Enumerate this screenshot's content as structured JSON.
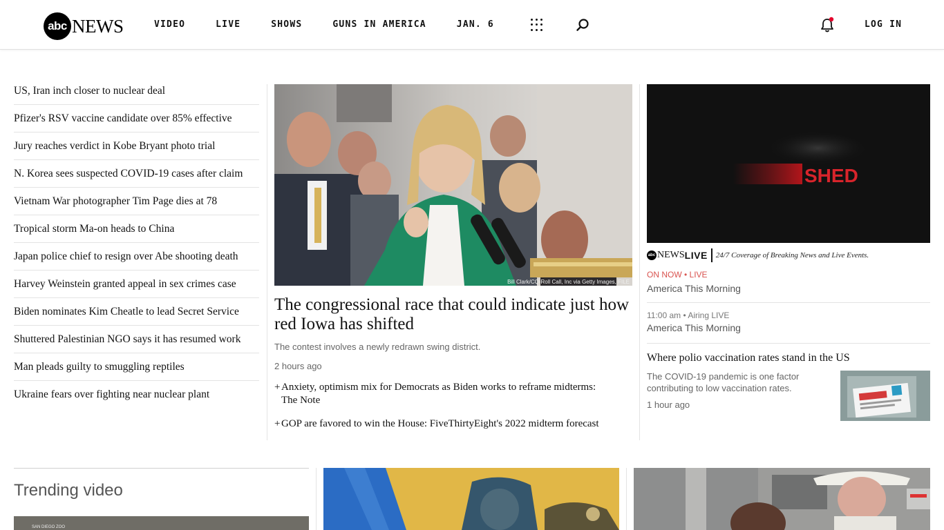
{
  "header": {
    "logo_mark": "abc",
    "logo_text": "NEWS",
    "nav": [
      "VIDEO",
      "LIVE",
      "SHOWS",
      "GUNS IN AMERICA",
      "JAN. 6"
    ],
    "login_label": "LOG IN"
  },
  "headlines": [
    "US, Iran inch closer to nuclear deal",
    "Pfizer's RSV vaccine candidate over 85% effective",
    "Jury reaches verdict in Kobe Bryant photo trial",
    "N. Korea sees suspected COVID-19 cases after claim",
    "Vietnam War photographer Tim Page dies at 78",
    "Tropical storm Ma-on heads to China",
    "Japan police chief to resign over Abe shooting death",
    "Harvey Weinstein granted appeal in sex crimes case",
    "Biden nominates Kim Cheatle to lead Secret Service",
    "Shuttered Palestinian NGO says it has resumed work",
    "Man pleads guilty to smuggling reptiles",
    "Ukraine fears over fighting near nuclear plant"
  ],
  "main_story": {
    "photo_credit": "Bill Clark/CQ-Roll Call, Inc via Getty Images, FILE",
    "title": "The congressional race that could indicate just how red Iowa has shifted",
    "description": "The contest involves a newly redrawn swing district.",
    "time": "2 hours ago",
    "related": [
      {
        "line1": "Anxiety, optimism mix for Democrats as Biden works to reframe midterms:",
        "line2": "The Note"
      },
      {
        "line1": "GOP are favored to win the House: FiveThirtyEight's 2022 midterm forecast",
        "line2": ""
      }
    ]
  },
  "live": {
    "video_overlay_text": "SHED",
    "brand_mark": "abc",
    "brand_news": "NEWS",
    "brand_live": "LIVE",
    "tagline": "24/7 Coverage of Breaking News and Live Events.",
    "on_now": "ON NOW • LIVE",
    "current_show": "America This Morning",
    "next_time": "11:00 am  •  Airing LIVE",
    "next_show": "America This Morning"
  },
  "side_story": {
    "title": "Where polio vaccination rates stand in the US",
    "description": "The COVID-19 pandemic is one factor contributing to low vaccination rates.",
    "time": "1 hour ago"
  },
  "trending": {
    "title": "Trending video",
    "thumb_label": "SAN DIEGO ZOO"
  },
  "colors": {
    "accent_red": "#d9534f",
    "notification_dot": "#e4002b"
  }
}
